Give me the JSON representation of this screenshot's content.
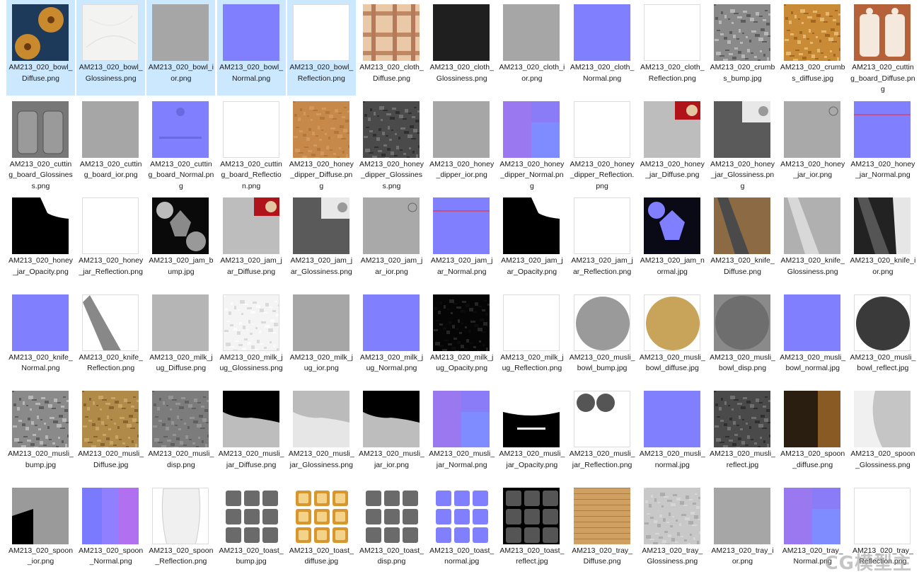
{
  "files": [
    {
      "name": "AM213_020_bowl_Diffuse.png",
      "selected": true,
      "thumb": "bowl-diffuse"
    },
    {
      "name": "AM213_020_bowl_Glossiness.png",
      "selected": true,
      "thumb": "white-soft"
    },
    {
      "name": "AM213_020_bowl_ior.png",
      "selected": true,
      "thumb": "gray"
    },
    {
      "name": "AM213_020_bowl_Normal.png",
      "selected": true,
      "thumb": "normal"
    },
    {
      "name": "AM213_020_bowl_Reflection.png",
      "selected": true,
      "thumb": "white"
    },
    {
      "name": "AM213_020_cloth_Diffuse.png",
      "selected": false,
      "thumb": "plaid"
    },
    {
      "name": "AM213_020_cloth_Glossiness.png",
      "selected": false,
      "thumb": "dark"
    },
    {
      "name": "AM213_020_cloth_ior.png",
      "selected": false,
      "thumb": "gray"
    },
    {
      "name": "AM213_020_cloth_Normal.png",
      "selected": false,
      "thumb": "normal"
    },
    {
      "name": "AM213_020_cloth_Reflection.png",
      "selected": false,
      "thumb": "white"
    },
    {
      "name": "AM213_020_crumbs_bump.jpg",
      "selected": false,
      "thumb": "noise-gray"
    },
    {
      "name": "AM213_020_crumbs_diffuse.jpg",
      "selected": false,
      "thumb": "crumbs"
    },
    {
      "name": "AM213_020_cutting_board_Diffuse.png",
      "selected": false,
      "thumb": "board-diffuse"
    },
    {
      "name": "AM213_020_cutting_board_Glossiness.png",
      "selected": false,
      "thumb": "board-gloss"
    },
    {
      "name": "AM213_020_cutting_board_ior.png",
      "selected": false,
      "thumb": "gray"
    },
    {
      "name": "AM213_020_cutting_board_Normal.png",
      "selected": false,
      "thumb": "normal-spots"
    },
    {
      "name": "AM213_020_cutting_board_Reflection.png",
      "selected": false,
      "thumb": "white"
    },
    {
      "name": "AM213_020_honey_dipper_Diffuse.png",
      "selected": false,
      "thumb": "wood"
    },
    {
      "name": "AM213_020_honey_dipper_Glossiness.png",
      "selected": false,
      "thumb": "noise-dark"
    },
    {
      "name": "AM213_020_honey_dipper_ior.png",
      "selected": false,
      "thumb": "gray"
    },
    {
      "name": "AM213_020_honey_dipper_Normal.png",
      "selected": false,
      "thumb": "normal-purple"
    },
    {
      "name": "AM213_020_honey_dipper_Reflection.png",
      "selected": false,
      "thumb": "white"
    },
    {
      "name": "AM213_020_honey_jar_Diffuse.png",
      "selected": false,
      "thumb": "jar-diffuse"
    },
    {
      "name": "AM213_020_honey_jar_Glossiness.png",
      "selected": false,
      "thumb": "jar-gloss"
    },
    {
      "name": "AM213_020_honey_jar_ior.png",
      "selected": false,
      "thumb": "gray-circle"
    },
    {
      "name": "AM213_020_honey_jar_Normal.png",
      "selected": false,
      "thumb": "normal-line"
    },
    {
      "name": "AM213_020_honey_jar_Opacity.png",
      "selected": false,
      "thumb": "opacity"
    },
    {
      "name": "AM213_020_honey_jar_Reflection.png",
      "selected": false,
      "thumb": "white"
    },
    {
      "name": "AM213_020_jam_bump.jpg",
      "selected": false,
      "thumb": "jam-bump"
    },
    {
      "name": "AM213_020_jam_jar_Diffuse.png",
      "selected": false,
      "thumb": "jar-diffuse"
    },
    {
      "name": "AM213_020_jam_jar_Glossiness.png",
      "selected": false,
      "thumb": "jar-gloss"
    },
    {
      "name": "AM213_020_jam_jar_ior.png",
      "selected": false,
      "thumb": "gray-circle"
    },
    {
      "name": "AM213_020_jam_jar_Normal.png",
      "selected": false,
      "thumb": "normal-line"
    },
    {
      "name": "AM213_020_jam_jar_Opacity.png",
      "selected": false,
      "thumb": "opacity"
    },
    {
      "name": "AM213_020_jam_jar_Reflection.png",
      "selected": false,
      "thumb": "white"
    },
    {
      "name": "AM213_020_jam_normal.jpg",
      "selected": false,
      "thumb": "jam-normal"
    },
    {
      "name": "AM213_020_knife_Diffuse.png",
      "selected": false,
      "thumb": "knife-diffuse"
    },
    {
      "name": "AM213_020_knife_Glossiness.png",
      "selected": false,
      "thumb": "knife-gloss"
    },
    {
      "name": "AM213_020_knife_ior.png",
      "selected": false,
      "thumb": "knife-ior"
    },
    {
      "name": "AM213_020_knife_Normal.png",
      "selected": false,
      "thumb": "normal"
    },
    {
      "name": "AM213_020_knife_Reflection.png",
      "selected": false,
      "thumb": "knife-refl"
    },
    {
      "name": "AM213_020_milk_jug_Diffuse.png",
      "selected": false,
      "thumb": "gray-light"
    },
    {
      "name": "AM213_020_milk_jug_Glossiness.png",
      "selected": false,
      "thumb": "white-specks"
    },
    {
      "name": "AM213_020_milk_jug_ior.png",
      "selected": false,
      "thumb": "gray"
    },
    {
      "name": "AM213_020_milk_jug_Normal.png",
      "selected": false,
      "thumb": "normal"
    },
    {
      "name": "AM213_020_milk_jug_Opacity.png",
      "selected": false,
      "thumb": "black-specks"
    },
    {
      "name": "AM213_020_milk_jug_Reflection.png",
      "selected": false,
      "thumb": "white"
    },
    {
      "name": "AM213_020_musli_bowl_bump.jpg",
      "selected": false,
      "thumb": "musli-bump"
    },
    {
      "name": "AM213_020_musli_bowl_diffuse.jpg",
      "selected": false,
      "thumb": "musli-diffuse"
    },
    {
      "name": "AM213_020_musli_bowl_disp.png",
      "selected": false,
      "thumb": "musli-disp"
    },
    {
      "name": "AM213_020_musli_bowl_normal.jpg",
      "selected": false,
      "thumb": "normal"
    },
    {
      "name": "AM213_020_musli_bowl_reflect.jpg",
      "selected": false,
      "thumb": "musli-reflect"
    },
    {
      "name": "AM213_020_musli_bump.jpg",
      "selected": false,
      "thumb": "noise-gray"
    },
    {
      "name": "AM213_020_musli_Diffuse.jpg",
      "selected": false,
      "thumb": "musli-d"
    },
    {
      "name": "AM213_020_musli_disp.png",
      "selected": false,
      "thumb": "noise-gray2"
    },
    {
      "name": "AM213_020_musli_jar_Diffuse.png",
      "selected": false,
      "thumb": "mjar-diffuse"
    },
    {
      "name": "AM213_020_musli_jar_Glossiness.png",
      "selected": false,
      "thumb": "mjar-gloss"
    },
    {
      "name": "AM213_020_musli_jar_ior.png",
      "selected": false,
      "thumb": "mjar-diffuse"
    },
    {
      "name": "AM213_020_musli_jar_Normal.png",
      "selected": false,
      "thumb": "normal-purple"
    },
    {
      "name": "AM213_020_musli_jar_Opacity.png",
      "selected": false,
      "thumb": "mjar-opacity"
    },
    {
      "name": "AM213_020_musli_jar_Reflection.png",
      "selected": false,
      "thumb": "mjar-refl"
    },
    {
      "name": "AM213_020_musli_normal.jpg",
      "selected": false,
      "thumb": "normal"
    },
    {
      "name": "AM213_020_musli_reflect.jpg",
      "selected": false,
      "thumb": "noise-dark"
    },
    {
      "name": "AM213_020_spoon_diffuse.png",
      "selected": false,
      "thumb": "spoon-diffuse"
    },
    {
      "name": "AM213_020_spoon_Glossiness.png",
      "selected": false,
      "thumb": "spoon-gloss"
    },
    {
      "name": "AM213_020_spoon_ior.png",
      "selected": false,
      "thumb": "spoon-ior"
    },
    {
      "name": "AM213_020_spoon_Normal.png",
      "selected": false,
      "thumb": "normal-spoon"
    },
    {
      "name": "AM213_020_spoon_Reflection.png",
      "selected": false,
      "thumb": "spoon-refl"
    },
    {
      "name": "AM213_020_toast_bump.jpg",
      "selected": false,
      "thumb": "toast-gray"
    },
    {
      "name": "AM213_020_toast_diffuse.jpg",
      "selected": false,
      "thumb": "toast-diffuse"
    },
    {
      "name": "AM213_020_toast_disp.png",
      "selected": false,
      "thumb": "toast-gray"
    },
    {
      "name": "AM213_020_toast_normal.jpg",
      "selected": false,
      "thumb": "toast-normal"
    },
    {
      "name": "AM213_020_toast_reflect.jpg",
      "selected": false,
      "thumb": "toast-reflect"
    },
    {
      "name": "AM213_020_tray_Diffuse.png",
      "selected": false,
      "thumb": "tray"
    },
    {
      "name": "AM213_020_tray_Glossiness.png",
      "selected": false,
      "thumb": "gray-specks"
    },
    {
      "name": "AM213_020_tray_ior.png",
      "selected": false,
      "thumb": "gray"
    },
    {
      "name": "AM213_020_tray_Normal.png",
      "selected": false,
      "thumb": "normal-purple"
    },
    {
      "name": "AM213_020_tray_Reflection.png",
      "selected": false,
      "thumb": "white"
    }
  ],
  "watermark": "CG模型主",
  "colors": {
    "selected_bg": "#cce8ff",
    "label": "#1a1a1a",
    "normal_blue": "#8080ff"
  }
}
